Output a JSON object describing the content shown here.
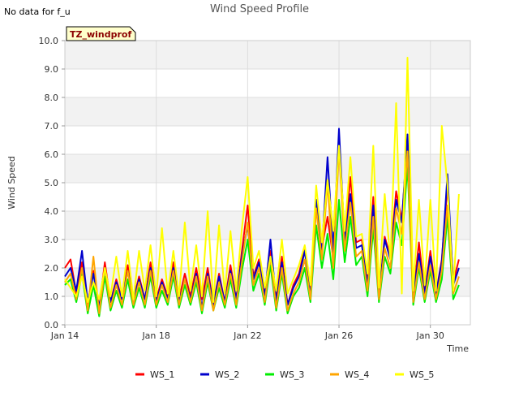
{
  "status_text": "No data for f_u",
  "chart_data": {
    "type": "line",
    "title": "Wind Speed Profile",
    "xlabel": "Time",
    "ylabel": "Wind Speed",
    "badge": "TZ_windprof",
    "xlim": [
      0,
      17.75
    ],
    "ylim": [
      0,
      10
    ],
    "y_ticks": [
      0,
      1,
      2,
      3,
      4,
      5,
      6,
      7,
      8,
      9,
      10
    ],
    "y_tick_labels": [
      "0.0",
      "1.0",
      "2.0",
      "3.0",
      "4.0",
      "5.0",
      "6.0",
      "7.0",
      "8.0",
      "9.0",
      "10.0"
    ],
    "x_ticks": [
      0,
      4,
      8,
      12,
      16
    ],
    "x_tick_labels": [
      "Jan 14",
      "Jan 18",
      "Jan 22",
      "Jan 26",
      "Jan 30"
    ],
    "x_unit_note": "days after Jan 14",
    "grid": true,
    "band_shading": "alternate",
    "legend_position": "bottom",
    "x": [
      0,
      0.25,
      0.5,
      0.75,
      1,
      1.25,
      1.5,
      1.75,
      2,
      2.25,
      2.5,
      2.75,
      3,
      3.25,
      3.5,
      3.75,
      4,
      4.25,
      4.5,
      4.75,
      5,
      5.25,
      5.5,
      5.75,
      6,
      6.25,
      6.5,
      6.75,
      7,
      7.25,
      7.5,
      7.75,
      8,
      8.25,
      8.5,
      8.75,
      9,
      9.25,
      9.5,
      9.75,
      10,
      10.25,
      10.5,
      10.75,
      11,
      11.25,
      11.5,
      11.75,
      12,
      12.25,
      12.5,
      12.75,
      13,
      13.25,
      13.5,
      13.75,
      14,
      14.25,
      14.5,
      14.75,
      15,
      15.25,
      15.5,
      15.75,
      16,
      16.25,
      16.5,
      16.75,
      17,
      17.25
    ],
    "series": [
      {
        "name": "WS_1",
        "color": "#ff0000",
        "values": [
          2.0,
          2.3,
          1.1,
          2.2,
          0.7,
          1.9,
          0.6,
          2.2,
          0.8,
          1.6,
          0.9,
          2.1,
          0.9,
          1.7,
          0.9,
          2.2,
          0.9,
          1.6,
          1.0,
          2.2,
          0.9,
          1.8,
          1.0,
          2.0,
          0.9,
          2.0,
          0.7,
          1.8,
          0.8,
          2.1,
          0.9,
          2.6,
          4.2,
          1.7,
          2.3,
          1.1,
          2.6,
          0.9,
          2.4,
          0.7,
          1.4,
          1.8,
          2.7,
          1.0,
          4.2,
          2.7,
          3.8,
          2.3,
          6.5,
          3.0,
          5.2,
          2.9,
          3.0,
          1.5,
          4.5,
          1.0,
          3.1,
          2.4,
          4.7,
          3.7,
          6.4,
          1.0,
          2.9,
          1.1,
          2.6,
          1.1,
          2.3,
          4.9,
          1.5,
          2.3
        ]
      },
      {
        "name": "WS_2",
        "color": "#0000cc",
        "values": [
          1.7,
          2.0,
          1.2,
          2.6,
          0.8,
          1.8,
          0.6,
          2.0,
          0.8,
          1.5,
          0.9,
          1.9,
          0.9,
          1.6,
          0.9,
          2.0,
          0.8,
          1.5,
          0.9,
          2.0,
          0.8,
          1.6,
          0.9,
          1.8,
          0.6,
          1.8,
          0.7,
          1.7,
          0.8,
          1.9,
          0.9,
          2.4,
          3.5,
          1.6,
          2.2,
          1.0,
          3.0,
          0.8,
          2.2,
          0.7,
          1.3,
          1.7,
          2.6,
          1.0,
          4.4,
          2.6,
          5.9,
          2.6,
          6.9,
          2.9,
          4.6,
          2.7,
          2.8,
          1.4,
          4.2,
          1.0,
          3.0,
          2.3,
          4.4,
          3.6,
          6.7,
          1.0,
          2.5,
          1.1,
          2.4,
          1.1,
          2.2,
          5.3,
          1.4,
          2.0
        ]
      },
      {
        "name": "WS_3",
        "color": "#00ee00",
        "values": [
          1.4,
          1.6,
          0.8,
          1.8,
          0.4,
          1.4,
          0.3,
          1.7,
          0.5,
          1.2,
          0.6,
          1.6,
          0.6,
          1.3,
          0.6,
          1.7,
          0.6,
          1.2,
          0.7,
          1.7,
          0.6,
          1.4,
          0.7,
          1.5,
          0.4,
          1.5,
          0.5,
          1.3,
          0.6,
          1.6,
          0.6,
          1.9,
          3.0,
          1.2,
          1.8,
          0.7,
          2.1,
          0.5,
          1.8,
          0.4,
          1.0,
          1.3,
          2.0,
          0.8,
          3.5,
          2.0,
          3.2,
          1.6,
          4.4,
          2.2,
          3.8,
          2.1,
          2.4,
          1.0,
          3.4,
          0.8,
          2.4,
          1.8,
          3.6,
          2.8,
          5.6,
          0.7,
          2.0,
          0.8,
          1.9,
          0.8,
          1.6,
          3.8,
          0.9,
          1.4
        ]
      },
      {
        "name": "WS_4",
        "color": "#ffa500",
        "values": [
          1.5,
          1.8,
          0.9,
          2.0,
          0.5,
          2.4,
          0.4,
          2.0,
          0.6,
          1.4,
          0.7,
          1.9,
          0.7,
          1.5,
          0.7,
          1.9,
          0.7,
          1.4,
          0.8,
          1.9,
          0.7,
          1.6,
          0.8,
          1.7,
          0.5,
          1.7,
          0.5,
          1.5,
          0.7,
          1.8,
          0.7,
          2.2,
          3.6,
          1.4,
          2.0,
          0.8,
          2.4,
          0.6,
          2.0,
          0.5,
          1.1,
          1.5,
          2.3,
          0.9,
          4.1,
          2.3,
          5.0,
          2.0,
          6.2,
          2.6,
          4.3,
          2.4,
          2.6,
          1.2,
          3.8,
          0.9,
          2.7,
          2.0,
          4.1,
          3.2,
          6.1,
          0.8,
          2.2,
          0.9,
          2.1,
          0.9,
          1.9,
          4.2,
          1.1,
          1.7
        ]
      },
      {
        "name": "WS_5",
        "color": "#ffff00",
        "values": [
          1.6,
          1.3,
          1.0,
          1.7,
          0.8,
          1.5,
          0.9,
          2.0,
          1.0,
          2.4,
          1.0,
          2.6,
          0.9,
          2.6,
          1.2,
          2.8,
          1.0,
          3.4,
          1.1,
          2.6,
          1.0,
          3.6,
          1.2,
          2.8,
          1.0,
          4.0,
          0.8,
          3.5,
          1.1,
          3.3,
          1.2,
          3.4,
          5.2,
          2.0,
          2.6,
          1.3,
          2.4,
          1.2,
          3.0,
          1.1,
          1.6,
          2.1,
          2.8,
          1.4,
          4.9,
          2.9,
          5.1,
          3.3,
          6.3,
          3.3,
          5.9,
          3.1,
          3.2,
          1.8,
          6.3,
          1.3,
          4.6,
          2.3,
          7.8,
          1.1,
          9.4,
          1.2,
          4.4,
          1.4,
          4.4,
          1.2,
          7.0,
          4.9,
          1.2,
          4.6
        ]
      }
    ]
  }
}
